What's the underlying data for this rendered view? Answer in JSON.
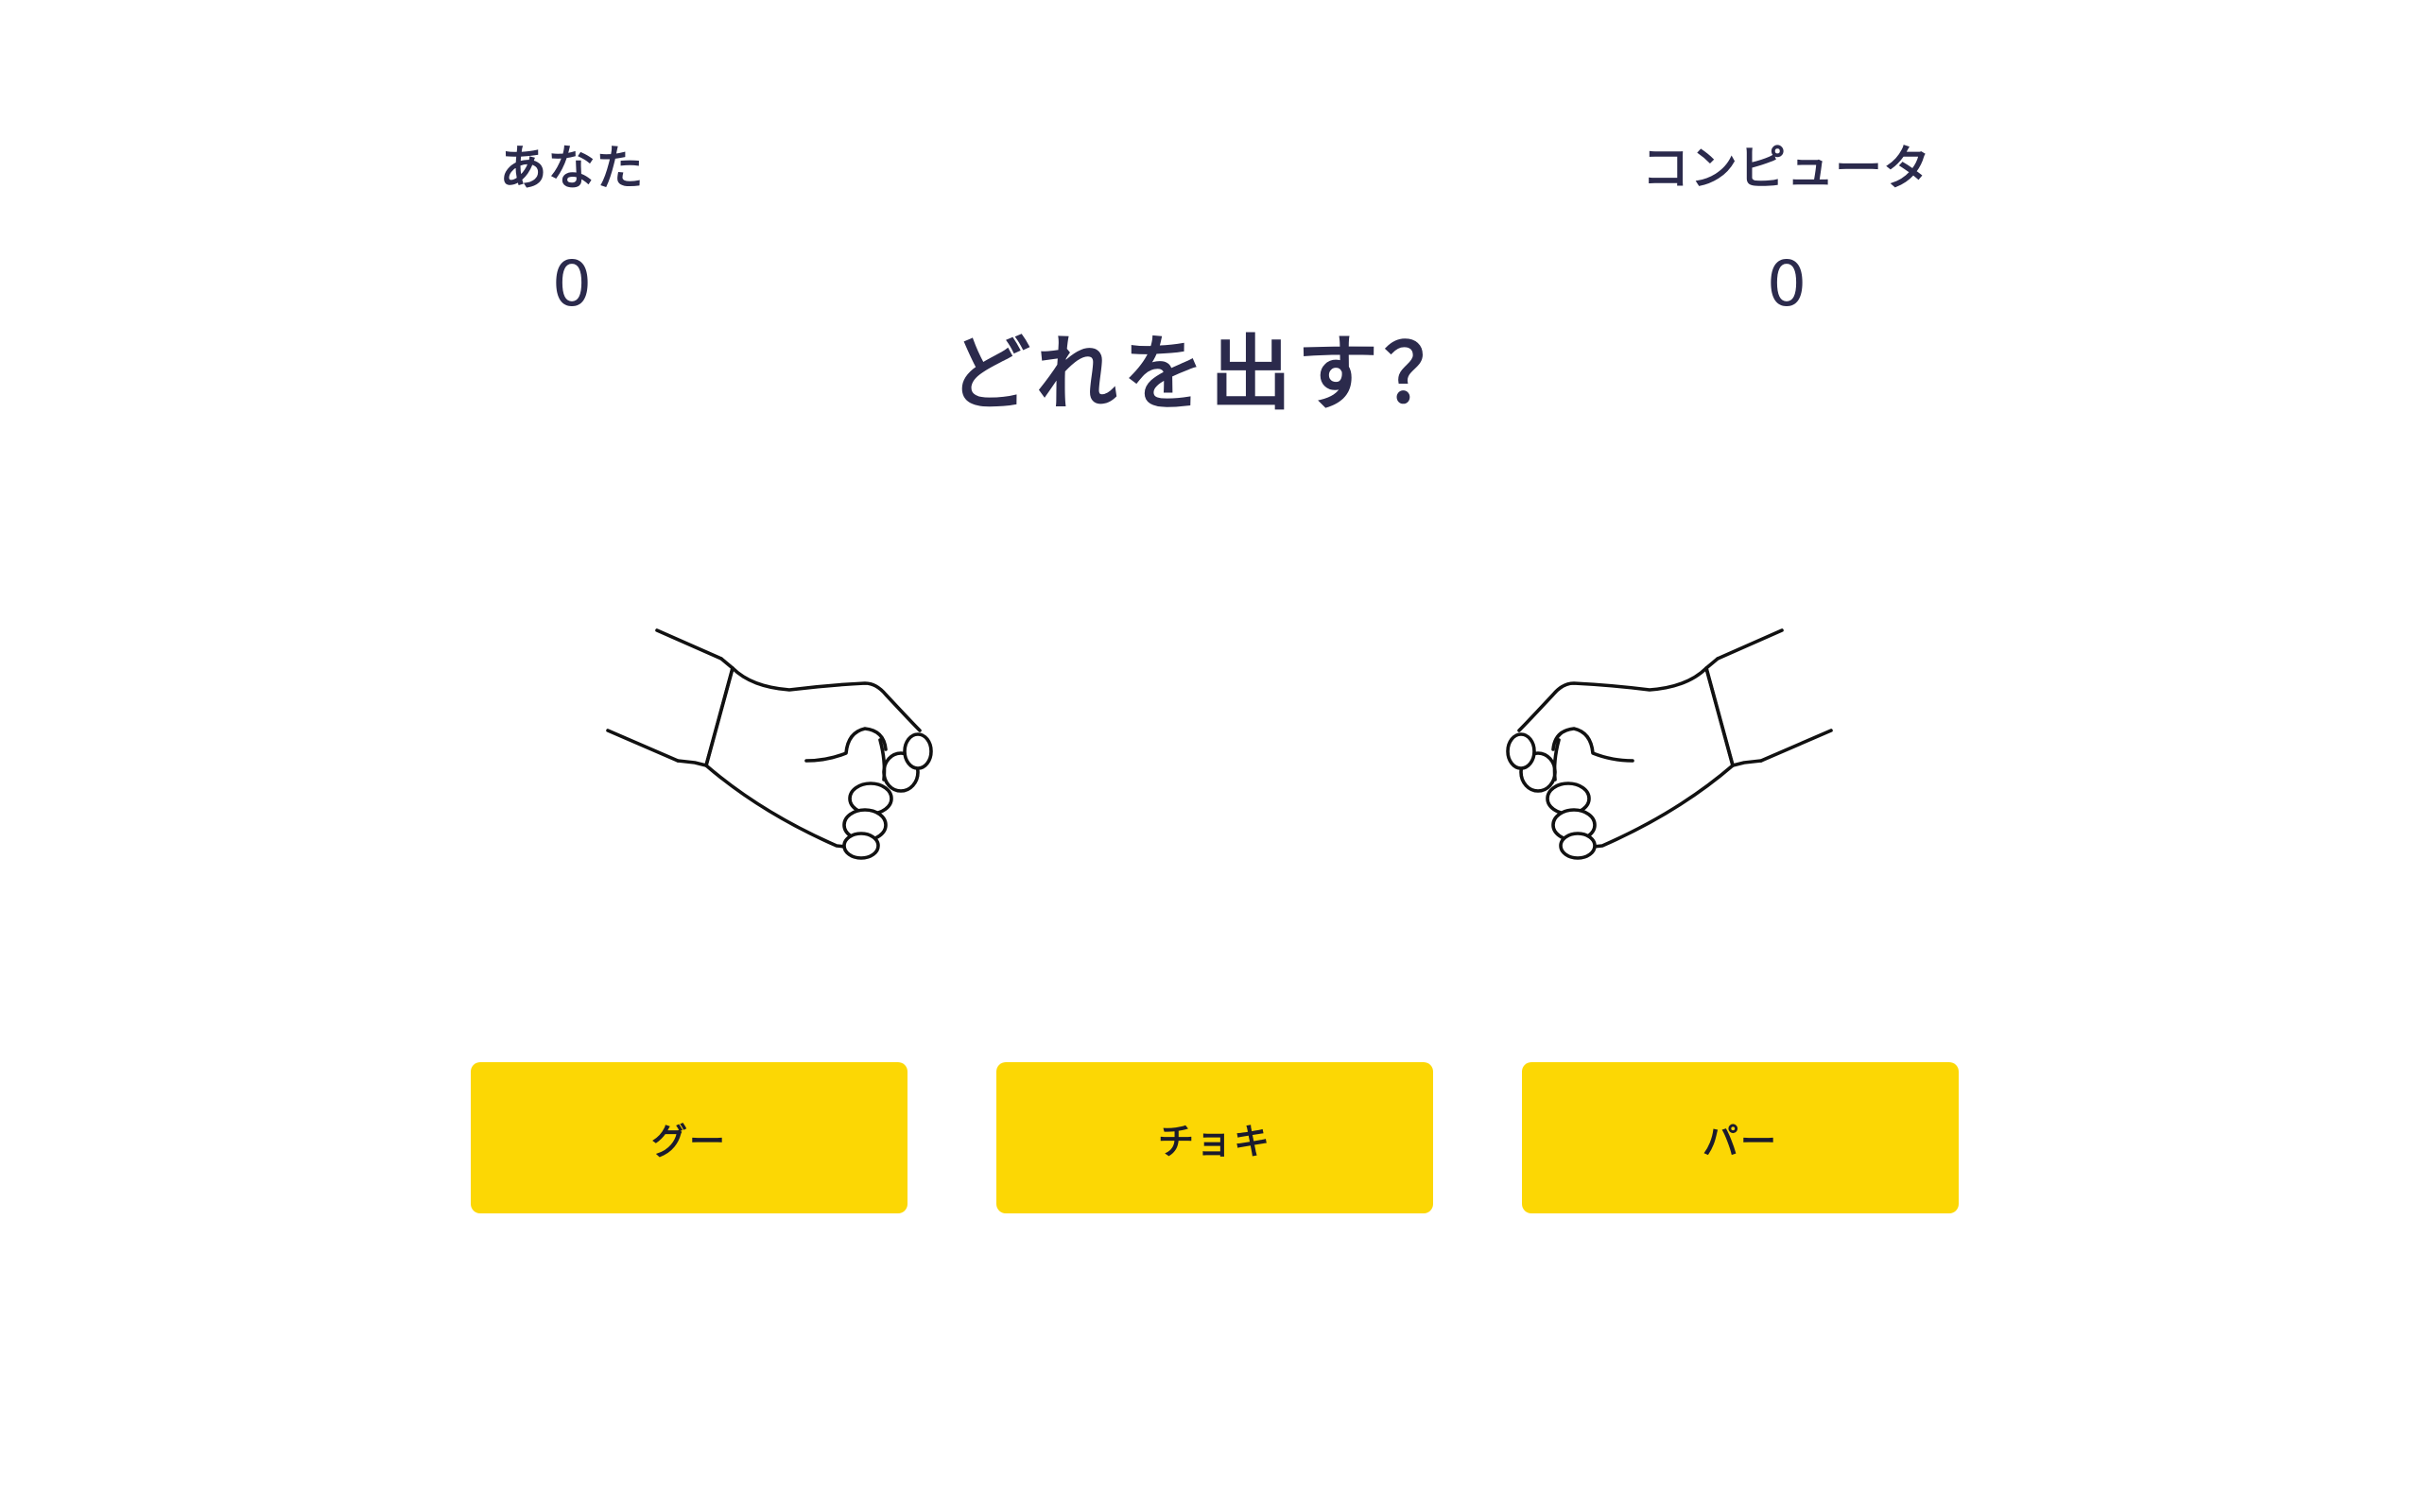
{
  "players": {
    "you": {
      "label": "あなた",
      "score": "0"
    },
    "computer": {
      "label": "コンピュータ",
      "score": "0"
    }
  },
  "prompt": "どれを出す？",
  "hands": {
    "you": {
      "shape": "rock"
    },
    "computer": {
      "shape": "rock"
    }
  },
  "choices": {
    "rock": "グー",
    "scissors": "チョキ",
    "paper": "パー"
  },
  "colors": {
    "button": "#fcd704",
    "text": "#2b2a4c",
    "background": "#ffffff"
  }
}
